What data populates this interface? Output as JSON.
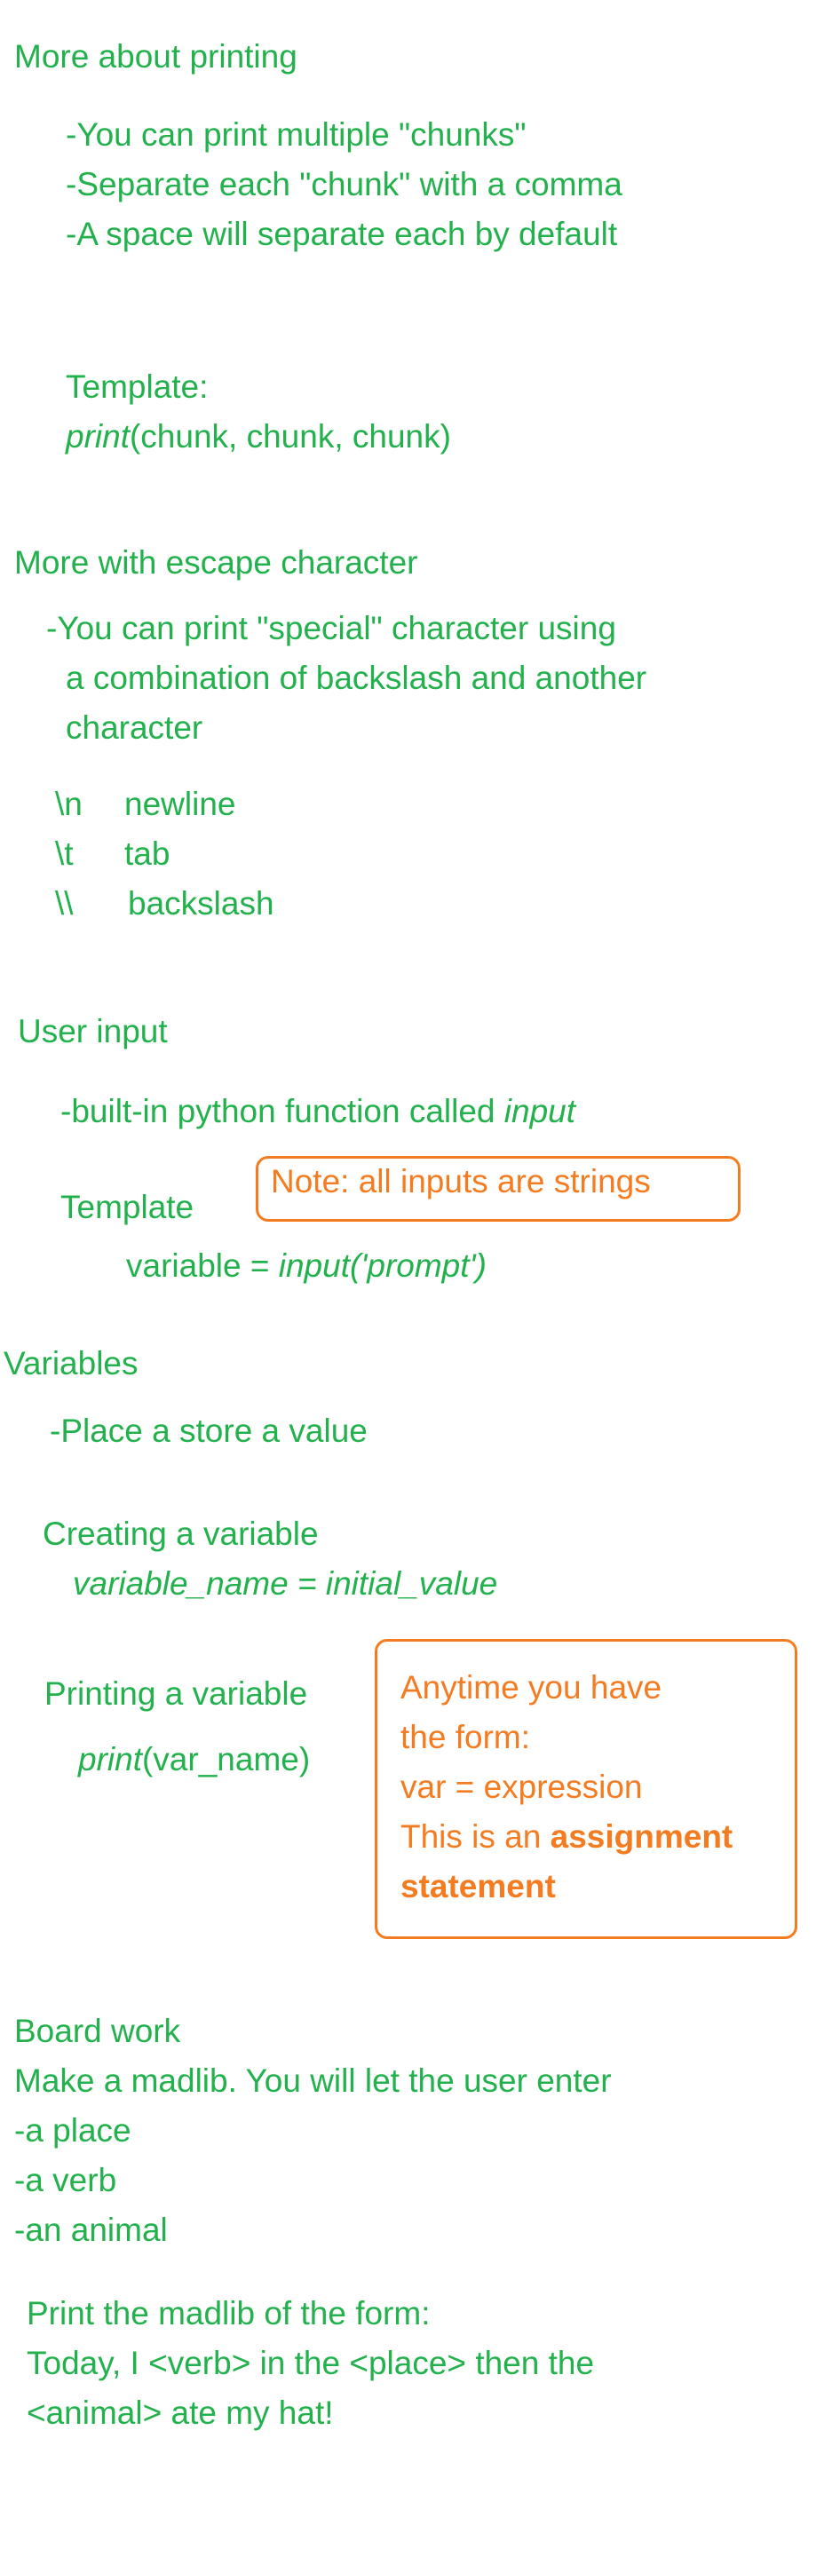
{
  "printing": {
    "heading": "More about printing",
    "bullets": [
      "-You can print multiple \"chunks\"",
      "-Separate each \"chunk\" with a comma",
      "-A space will separate each by default"
    ],
    "template_label": "Template:",
    "template_fn": "print",
    "template_args": "(chunk, chunk, chunk)"
  },
  "escape": {
    "heading": "More with escape character",
    "desc_lines": [
      "-You can print \"special\" character using",
      "a combination of backslash and another",
      "character"
    ],
    "items": [
      {
        "code": "\\n",
        "label": "newline"
      },
      {
        "code": "\\t",
        "label": "tab"
      },
      {
        "code": "\\\\",
        "label": "backslash"
      }
    ]
  },
  "input": {
    "heading": "User input",
    "desc_prefix": "-built-in python function called ",
    "desc_fn": "input",
    "template_label": "Template",
    "note": "Note: all inputs are strings",
    "code_var": "variable = ",
    "code_call": "input('prompt')"
  },
  "variables": {
    "heading": "Variables",
    "desc": "-Place a store a value",
    "creating_label": "Creating a variable",
    "creating_code": "variable_name = initial_value",
    "printing_label": "Printing a variable",
    "printing_fn": "print",
    "printing_args": "(var_name)",
    "note_lines": [
      "Anytime you have",
      "the form:",
      "var = expression"
    ],
    "note_prefix": "This is an ",
    "note_bold_1": "assignment",
    "note_bold_2": "statement"
  },
  "board": {
    "heading": "Board work",
    "intro": "Make a madlib. You will let the user enter",
    "list": [
      "-a place",
      "-a verb",
      "-an animal"
    ],
    "print_label": "Print the madlib of the form:",
    "madlib_lines": [
      "Today, I <verb> in the <place> then the",
      "<animal> ate my hat!"
    ]
  }
}
